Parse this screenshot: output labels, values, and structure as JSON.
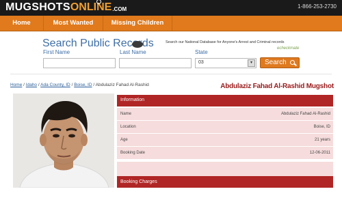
{
  "header": {
    "logo_main": "MUGSHOTS",
    "logo_online": "ONLINE",
    "logo_com": ".COM",
    "phone": "1-866-253-2730"
  },
  "nav": {
    "items": [
      "Home",
      "Most Wanted",
      "Missing Children"
    ]
  },
  "search": {
    "title": "Search Public Records",
    "description": "Search our National Database for Anyone's Arrest and Criminal records",
    "ecm": "echeckmate",
    "first_name_label": "First Name",
    "last_name_label": "Last Name",
    "state_label": "State",
    "first_name_value": "",
    "last_name_value": "",
    "state_value": "03",
    "button_label": "Search"
  },
  "breadcrumb": {
    "items": [
      "Home",
      "Idaho",
      "Ada County, ID",
      "Boise, ID"
    ],
    "current": "Abdulaziz Fahad Al-Rashid",
    "separator": "/"
  },
  "heading": "Abdulaziz Fahad Al-Rashid Mugshot",
  "info": {
    "header": "Information",
    "rows": [
      {
        "label": "Name",
        "value": "Abdulaziz Fahad Al-Rashid"
      },
      {
        "label": "Location",
        "value": "Boise, ID"
      },
      {
        "label": "Age",
        "value": "21 years"
      },
      {
        "label": "Booking Date",
        "value": "12-06-2011"
      }
    ],
    "charges_header": "Booking Charges"
  },
  "colors": {
    "topbar": "#1a1a1a",
    "nav": "#e07a1c",
    "accent_blue": "#3d6ea6",
    "panel_red": "#b02525",
    "row_pink": "#f6dcdc",
    "heading_red": "#9a1a1a"
  },
  "icons": [
    "search-icon",
    "select-arrow-icon"
  ]
}
